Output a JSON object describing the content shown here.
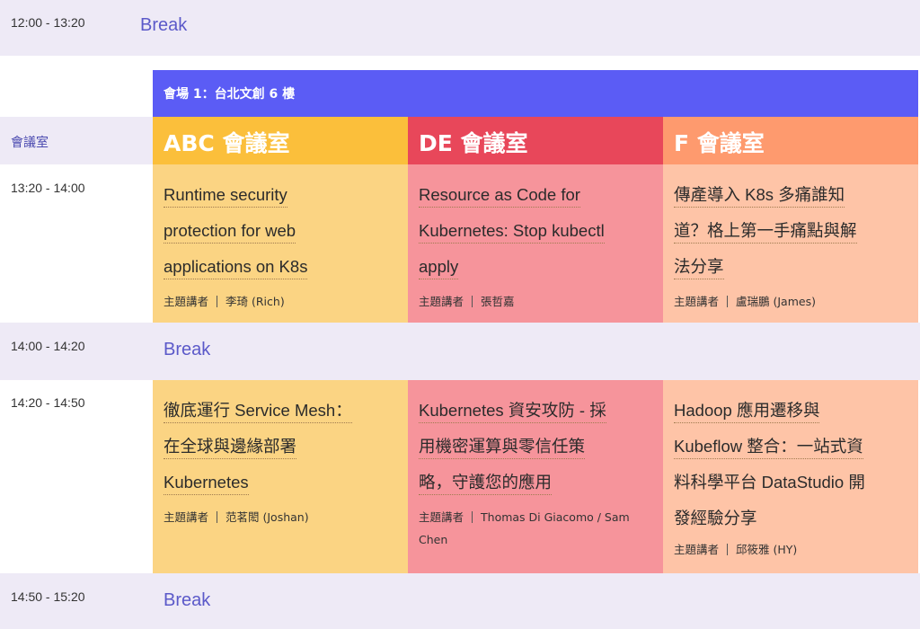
{
  "colors": {
    "accent": "#5b5cf5",
    "break_bg": "#eeeaf6",
    "abc_header": "#fbbf3b",
    "de_header": "#e8475a",
    "f_header": "#fe9a6e",
    "abc_cell": "#fbd483",
    "de_cell": "#f6949b",
    "f_cell": "#fec4a7"
  },
  "rows": {
    "break1": {
      "time": "12:00 - 13:20",
      "label": "Break"
    },
    "slot1": {
      "time": "13:20 - 14:00"
    },
    "break2": {
      "time": "14:00 - 14:20",
      "label": "Break"
    },
    "slot2": {
      "time": "14:20 - 14:50"
    },
    "break3": {
      "time": "14:50 - 15:20",
      "label": "Break"
    }
  },
  "venue": {
    "title": "會場 1：台北文創 6 樓"
  },
  "room_label": "會議室",
  "rooms": [
    "ABC 會議室",
    "DE 會議室",
    "F 會議室"
  ],
  "speaker_prefix": "主題講者",
  "sessions": {
    "slot1": [
      {
        "title": "Runtime security protection for web applications on K8s",
        "speaker": "李琦 (Rich)"
      },
      {
        "title": "Resource as Code for Kubernetes: Stop kubectl apply",
        "speaker": "張哲嘉"
      },
      {
        "title": "傳產導入 K8s 多痛誰知道？格上第一手痛點與解法分享",
        "speaker": "盧瑞鵬 (James)"
      }
    ],
    "slot2": [
      {
        "title": "徹底運行 Service Mesh：在全球與邊緣部署 Kubernetes",
        "speaker": "范茗閎 (Joshan)"
      },
      {
        "title": "Kubernetes 資安攻防 - 採用機密運算與零信任策略，守護您的應用",
        "speaker": "Thomas Di Giacomo / Sam Chen"
      },
      {
        "title": "Hadoop 應用遷移與 Kubeflow 整合：一站式資料科學平台 DataStudio 開發經驗分享",
        "speaker": "邱筱雅 (HY)"
      }
    ]
  },
  "title_lines": {
    "s1a": [
      "Runtime security",
      "protection for web",
      "applications on K8s"
    ],
    "s1b": [
      "Resource as Code for",
      "Kubernetes: Stop kubectl",
      "apply"
    ],
    "s1c": [
      "傳產導入 K8s 多痛誰知",
      "道？格上第一手痛點與解",
      "法分享"
    ],
    "s2a": [
      "徹底運行 Service Mesh：",
      "在全球與邊緣部署",
      "Kubernetes"
    ],
    "s2b": [
      "Kubernetes 資安攻防 - 採",
      "用機密運算與零信任策",
      "略，守護您的應用"
    ],
    "s2c": [
      "Hadoop 應用遷移與",
      "Kubeflow 整合：一站式資",
      "料科學平台 DataStudio 開",
      "發經驗分享"
    ]
  }
}
